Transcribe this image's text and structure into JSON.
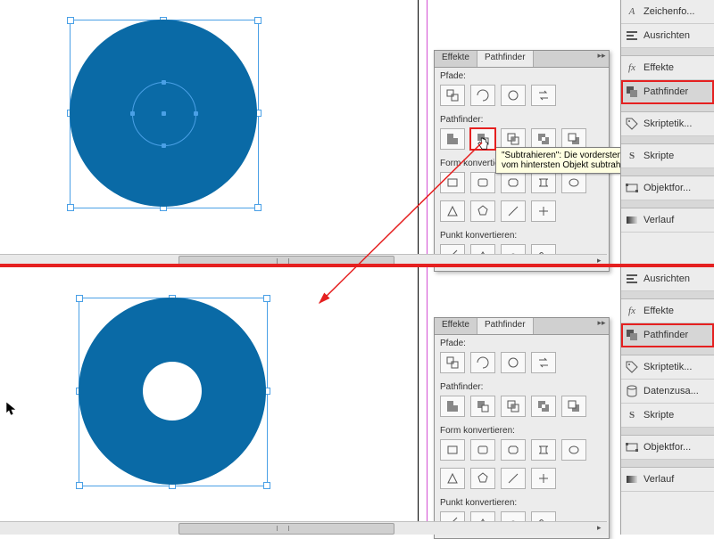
{
  "colors": {
    "shape_fill": "#0a6aa6",
    "accent_red": "#e52020",
    "selection": "#4aa0e6"
  },
  "panel": {
    "tabs": {
      "effekte": "Effekte",
      "pathfinder": "Pathfinder"
    },
    "sections": {
      "pfade": "Pfade:",
      "pathfinder": "Pathfinder:",
      "form": "Form konvertieren:",
      "punkt": "Punkt konvertieren:"
    }
  },
  "tooltip": {
    "text": "\"Subtrahieren\": Die vordersten Objekte werden vom hintersten Objekt subtrahiert"
  },
  "sidebar": {
    "items_top": [
      {
        "icon": "A",
        "label": "Zeichenfo..."
      },
      {
        "icon": "align",
        "label": "Ausrichten"
      },
      {
        "gap": true
      },
      {
        "icon": "fx",
        "label": "Effekte"
      },
      {
        "icon": "pf",
        "label": "Pathfinder",
        "hl": true
      },
      {
        "gap": true
      },
      {
        "icon": "tag",
        "label": "Skriptetik..."
      },
      {
        "gap": true
      },
      {
        "icon": "S",
        "label": "Skripte"
      },
      {
        "gap": true
      },
      {
        "icon": "obj",
        "label": "Objektfor..."
      },
      {
        "gap": true
      },
      {
        "icon": "grad",
        "label": "Verlauf"
      }
    ],
    "items_bottom_extra": [
      {
        "icon": "align",
        "label": "Ausrichten"
      },
      {
        "gap": true
      },
      {
        "icon": "fx",
        "label": "Effekte"
      },
      {
        "icon": "pf",
        "label": "Pathfinder",
        "hl": true
      },
      {
        "gap": true
      },
      {
        "icon": "tag",
        "label": "Skriptetik..."
      },
      {
        "icon": "data",
        "label": "Datenzusa..."
      },
      {
        "icon": "S",
        "label": "Skripte"
      },
      {
        "gap": true
      },
      {
        "icon": "obj",
        "label": "Objektfor..."
      },
      {
        "gap": true
      },
      {
        "icon": "grad",
        "label": "Verlauf"
      }
    ]
  }
}
